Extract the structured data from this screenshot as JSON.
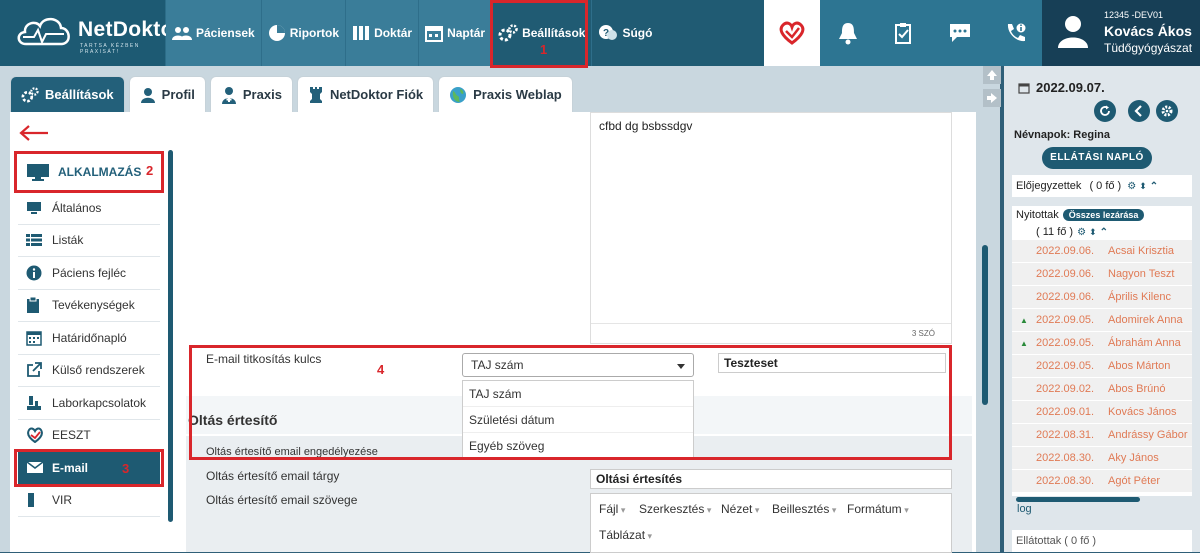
{
  "app": {
    "name": "NetDoktor",
    "tagline": "TARTSA KÉZBEN PRAXISÁT!"
  },
  "nav": [
    {
      "label": "Páciensek",
      "icon": "users-icon"
    },
    {
      "label": "Riportok",
      "icon": "pie-chart-icon"
    },
    {
      "label": "Doktár",
      "icon": "books-icon"
    },
    {
      "label": "Naptár",
      "icon": "calendar-icon"
    },
    {
      "label": "Beállítások",
      "icon": "gears-icon"
    },
    {
      "label": "Súgó",
      "icon": "help-icon"
    }
  ],
  "annotations": {
    "n1": "1",
    "n2": "2",
    "n3": "3",
    "n4": "4"
  },
  "user": {
    "id": "12345 -DEV01",
    "name": "Kovács Ákos",
    "specialty": "Tüdőgyógyászat"
  },
  "tabs": [
    {
      "label": "Beállítások",
      "icon": "gears-icon"
    },
    {
      "label": "Profil",
      "icon": "user-icon"
    },
    {
      "label": "Praxis",
      "icon": "doctor-icon"
    },
    {
      "label": "NetDoktor Fiók",
      "icon": "chess-rook-icon"
    },
    {
      "label": "Praxis Weblap",
      "icon": "globe-icon"
    }
  ],
  "sidebar": {
    "group": "ALKALMAZÁS",
    "items": [
      {
        "label": "Általános",
        "icon": "monitor-icon"
      },
      {
        "label": "Listák",
        "icon": "list-icon"
      },
      {
        "label": "Páciens fejléc",
        "icon": "info-icon"
      },
      {
        "label": "Tevékenységek",
        "icon": "clipboard-icon"
      },
      {
        "label": "Határidőnapló",
        "icon": "calendar-grid-icon"
      },
      {
        "label": "Külső rendszerek",
        "icon": "external-link-icon"
      },
      {
        "label": "Laborkapcsolatok",
        "icon": "lab-icon"
      },
      {
        "label": "EESZT",
        "icon": "eeszt-icon"
      },
      {
        "label": "E-mail",
        "icon": "envelope-icon"
      },
      {
        "label": "VIR",
        "icon": "vir-icon"
      }
    ]
  },
  "editor": {
    "text": "cfbd dg bsbssdgv",
    "word_count": "3 SZÓ"
  },
  "email_key": {
    "label": "E-mail titkosítás kulcs",
    "selected": "TAJ szám",
    "options": [
      "TAJ szám",
      "Születési dátum",
      "Egyéb szöveg"
    ],
    "custom_value": "Teszteset"
  },
  "oltas": {
    "title": "Oltás értesítő",
    "enable_label": "Oltás értesítő email engedélyezése",
    "subject_label": "Oltás értesítő email tárgy",
    "subject_value": "Oltási értesítés",
    "body_label": "Oltás értesítő email szövege",
    "toolbar": [
      "Fájl",
      "Szerkesztés",
      "Nézet",
      "Beillesztés",
      "Formátum"
    ],
    "toolbar2": "Táblázat"
  },
  "right": {
    "date": "2022.09.07.",
    "nameday": "Névnapok: Regina",
    "log_button": "ELLÁTÁSI NAPLÓ",
    "booked": "Előjegyzettek",
    "booked_count": "( 0 fő )",
    "open": "Nyitottak",
    "close_all": "Összes lezárása",
    "open_count": "( 11 fő )",
    "patients": [
      {
        "date": "2022.09.06.",
        "name": "Acsai Krisztia",
        "mark": ""
      },
      {
        "date": "2022.09.06.",
        "name": "Nagyon Teszt",
        "mark": ""
      },
      {
        "date": "2022.09.06.",
        "name": "Április Kilenc",
        "mark": ""
      },
      {
        "date": "2022.09.05.",
        "name": "Adomirek Anna",
        "mark": "▲"
      },
      {
        "date": "2022.09.05.",
        "name": "Ábrahám Anna",
        "mark": "▲"
      },
      {
        "date": "2022.09.05.",
        "name": "Abos Márton",
        "mark": ""
      },
      {
        "date": "2022.09.02.",
        "name": "Abos Brúnó",
        "mark": ""
      },
      {
        "date": "2022.09.01.",
        "name": "Kovács János",
        "mark": ""
      },
      {
        "date": "2022.08.31.",
        "name": "Andrássy Gábor",
        "mark": ""
      },
      {
        "date": "2022.08.30.",
        "name": "Aky János",
        "mark": ""
      },
      {
        "date": "2022.08.30.",
        "name": "Agót Péter",
        "mark": ""
      }
    ],
    "log_link": "log",
    "bottom": "Ellátottak ( 0 fő )"
  },
  "colors": {
    "accent": "#1e5a72",
    "highlight": "#d9262b",
    "date_orange": "#e07a55"
  }
}
